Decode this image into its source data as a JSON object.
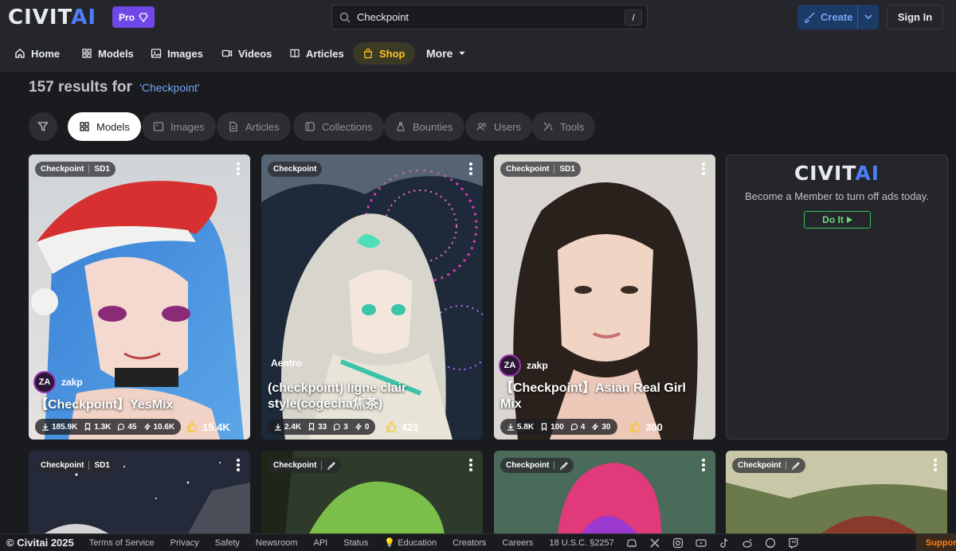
{
  "header": {
    "logo_text_a": "CIVIT",
    "logo_text_b": "AI",
    "pro_label": "Pro",
    "search_value": "Checkpoint",
    "search_shortcut": "/",
    "create_label": "Create",
    "signin_label": "Sign In"
  },
  "nav": {
    "items": [
      {
        "label": "Home",
        "icon": "home-icon"
      },
      {
        "label": "Models",
        "icon": "grid-icon"
      },
      {
        "label": "Images",
        "icon": "image-icon"
      },
      {
        "label": "Videos",
        "icon": "video-icon"
      },
      {
        "label": "Articles",
        "icon": "book-icon"
      },
      {
        "label": "Shop",
        "icon": "shopping-bag-icon"
      },
      {
        "label": "More",
        "icon": "caret-down-icon"
      }
    ]
  },
  "results": {
    "count_text": "157 results for",
    "query": "'Checkpoint'"
  },
  "filters": [
    {
      "label": "Models",
      "active": true
    },
    {
      "label": "Images"
    },
    {
      "label": "Articles"
    },
    {
      "label": "Collections"
    },
    {
      "label": "Bounties"
    },
    {
      "label": "Users"
    },
    {
      "label": "Tools"
    }
  ],
  "cards": [
    {
      "type": "Checkpoint",
      "base": "SD1",
      "avatar": "ZA",
      "user": "zakp",
      "title": "【Checkpoint】YesMix",
      "downloads": "185.9K",
      "saves": "1.3K",
      "comments": "45",
      "buzz": "10.6K",
      "likes": "15.4K"
    },
    {
      "type": "Checkpoint",
      "user": "Aentro",
      "title": "(checkpoint) ligne clair style(cogecha焦茶)",
      "downloads": "2.4K",
      "saves": "33",
      "comments": "3",
      "buzz": "0",
      "likes": "421"
    },
    {
      "type": "Checkpoint",
      "base": "SD1",
      "avatar": "ZA",
      "user": "zakp",
      "title": "【Checkpoint】Asian Real Girl Mix",
      "downloads": "5.8K",
      "saves": "100",
      "comments": "4",
      "buzz": "30",
      "likes": "300"
    }
  ],
  "row2": [
    {
      "type": "Checkpoint",
      "base": "SD1"
    },
    {
      "type": "Checkpoint"
    },
    {
      "type": "Checkpoint"
    },
    {
      "type": "Checkpoint"
    }
  ],
  "ad": {
    "logo_a": "CIVIT",
    "logo_b": "AI",
    "text": "Become a Member to turn off ads today.",
    "button": "Do It"
  },
  "footer": {
    "copyright": "© Civitai 2025",
    "links": [
      "Terms of Service",
      "Privacy",
      "Safety",
      "Newsroom",
      "API",
      "Status",
      "Education",
      "Creators",
      "Careers",
      "18 U.S.C. §2257"
    ],
    "support": "Support"
  }
}
